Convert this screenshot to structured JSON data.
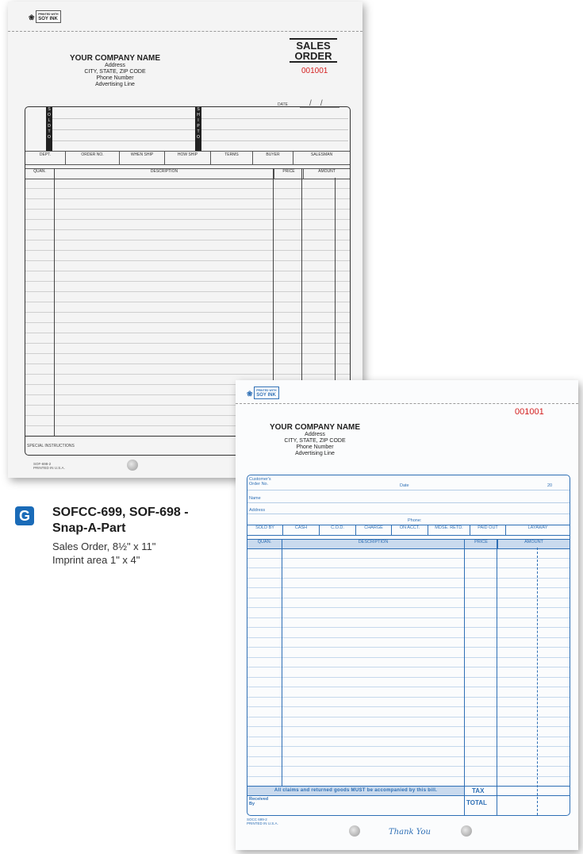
{
  "form1": {
    "soy_printed": "PRINTED WITH",
    "soy_ink": "SOY INK",
    "title_line1": "SALES",
    "title_line2": "ORDER",
    "number": "001001",
    "company": "YOUR COMPANY NAME",
    "address_lines": [
      "Address",
      "CITY, STATE, ZIP CODE",
      "Phone Number",
      "Advertising Line"
    ],
    "date_label": "DATE",
    "sold_to": [
      "S",
      "O",
      "L",
      "D",
      "",
      "T",
      "O"
    ],
    "ship_to": [
      "S",
      "H",
      "I",
      "P",
      "",
      "T",
      "O"
    ],
    "info_headers": [
      "DEPT.",
      "ORDER NO.",
      "WHEN SHIP",
      "HOW SHIP",
      "TERMS",
      "BUYER",
      "SALESMAN"
    ],
    "col_headers": {
      "quan": "QUAN.",
      "desc": "DESCRIPTION",
      "price": "PRICE",
      "amount": "AMOUNT"
    },
    "special": "SPECIAL INSTRUCTIONS",
    "footer_code": "SOF-698-2",
    "footer_printed": "PRINTED IN U.S.A."
  },
  "caption": {
    "badge": "G",
    "title_line1": "SOFCC-699, SOF-698 -",
    "title_line2": "Snap-A-Part",
    "desc_line1": "Sales Order, 8½\" x 11\"",
    "desc_line2": "Imprint area 1\" x 4\""
  },
  "form2": {
    "soy_printed": "PRINTED WITH",
    "soy_ink": "SOY INK",
    "number": "001001",
    "company": "YOUR COMPANY NAME",
    "address_lines": [
      "Address",
      "CITY, STATE, ZIP CODE",
      "Phone Number",
      "Advertising Line"
    ],
    "customers": "Customer's",
    "order_no": "Order No.",
    "date": "Date",
    "year": "20",
    "name": "Name",
    "address": "Address",
    "phone": "Phone:",
    "pay_headers": [
      "SOLD BY",
      "CASH",
      "C.O.D.",
      "CHARGE",
      "ON ACCT.",
      "MDSE. RETD.",
      "PAID OUT",
      "LAYAWAY"
    ],
    "col_headers": {
      "quan": "QUAN.",
      "desc": "DESCRIPTION",
      "price": "PRICE",
      "amount": "AMOUNT"
    },
    "claims": "All claims and returned goods MUST be accompanied by this bill.",
    "tax": "TAX",
    "received": "Received",
    "by": "By",
    "total": "TOTAL",
    "thank_you": "Thank You",
    "footer_code": "SOCC 699-2",
    "footer_printed": "PRINTED IN U.S.A."
  },
  "colors": {
    "badge": "#1a6bb8",
    "form2_ink": "#2e6fb5",
    "number_red": "#d42020"
  }
}
